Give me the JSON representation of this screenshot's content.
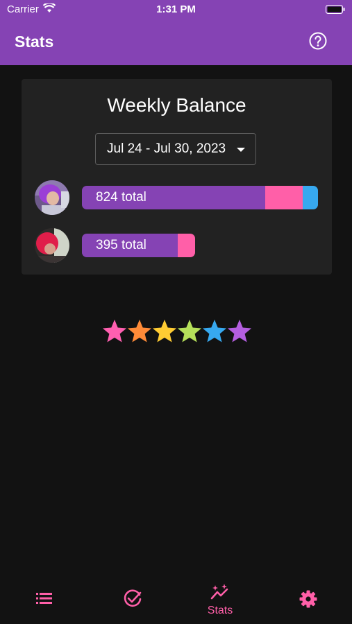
{
  "status_bar": {
    "carrier": "Carrier",
    "time": "1:31 PM"
  },
  "header": {
    "title": "Stats",
    "help_icon": "help-circle-icon"
  },
  "weekly_balance": {
    "title": "Weekly Balance",
    "date_range": "Jul 24 - Jul 30, 2023",
    "members": [
      {
        "avatar": "user-avatar-purple-hair",
        "total_label": "824 total",
        "total": 824,
        "segments": [
          {
            "color": "#8543b4",
            "fraction": 0.776
          },
          {
            "color": "#ff5fa8",
            "fraction": 0.16
          },
          {
            "color": "#37a9f0",
            "fraction": 0.064
          }
        ],
        "bar_fraction": 1.0
      },
      {
        "avatar": "user-avatar-pink-hair",
        "total_label": "395 total",
        "total": 395,
        "segments": [
          {
            "color": "#8543b4",
            "fraction": 0.845
          },
          {
            "color": "#ff5fa8",
            "fraction": 0.155
          }
        ],
        "bar_fraction": 0.479
      }
    ]
  },
  "rating_stars": {
    "count": 6,
    "colors": [
      "#ff5fb0",
      "#ff8b38",
      "#ffcc33",
      "#b5e05a",
      "#37a9f0",
      "#b45ee0"
    ]
  },
  "bottom_nav": {
    "items": [
      {
        "icon": "list-icon",
        "label": ""
      },
      {
        "icon": "check-circle-icon",
        "label": ""
      },
      {
        "icon": "trending-sparkle-icon",
        "label": "Stats",
        "active": true
      },
      {
        "icon": "gear-icon",
        "label": ""
      }
    ],
    "accent": "#ff5fa8"
  }
}
